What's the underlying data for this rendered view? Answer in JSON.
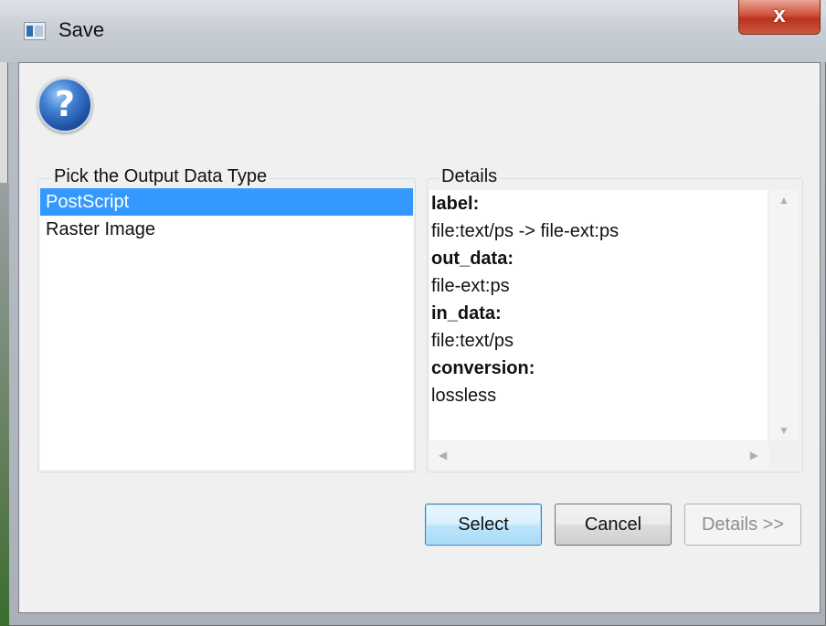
{
  "window": {
    "title": "Save",
    "close_glyph": "x"
  },
  "dialog": {
    "help_icon_glyph": "?"
  },
  "output_types": {
    "legend": "Pick the Output Data Type",
    "items": [
      {
        "label": "PostScript",
        "selected": true
      },
      {
        "label": "Raster Image",
        "selected": false
      }
    ]
  },
  "details": {
    "legend": "Details",
    "lines": [
      {
        "text": "label:",
        "bold": true
      },
      {
        "text": "file:text/ps -> file-ext:ps",
        "bold": false
      },
      {
        "text": "out_data:",
        "bold": true
      },
      {
        "text": "file-ext:ps",
        "bold": false
      },
      {
        "text": "in_data:",
        "bold": true
      },
      {
        "text": "file:text/ps",
        "bold": false
      },
      {
        "text": "conversion:",
        "bold": true
      },
      {
        "text": "lossless",
        "bold": false
      }
    ]
  },
  "buttons": {
    "select_label": "Select",
    "cancel_label": "Cancel",
    "details_label": "Details >>",
    "details_enabled": false
  },
  "colors": {
    "selection": "#3399ff",
    "close_button": "#c7432b",
    "default_button_border": "#3c7fb1"
  }
}
